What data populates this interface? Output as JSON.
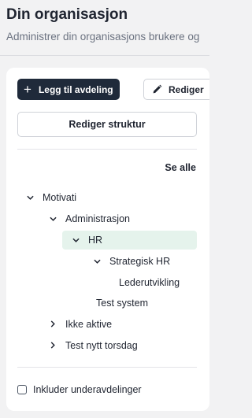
{
  "header": {
    "title": "Din organisasjon",
    "subtitle": "Administrer din organisasjons brukere og"
  },
  "toolbar": {
    "add_label": "Legg til avdeling",
    "edit_label": "Rediger",
    "structure_label": "Rediger struktur"
  },
  "tree": {
    "see_all": "Se alle",
    "nodes": [
      {
        "label": "Motivati",
        "expanded": true
      },
      {
        "label": "Administrasjon",
        "expanded": true
      },
      {
        "label": "HR",
        "expanded": true,
        "selected": true
      },
      {
        "label": "Strategisk HR",
        "expanded": true
      },
      {
        "label": "Lederutvikling"
      },
      {
        "label": "Test system"
      },
      {
        "label": "Ikke aktive",
        "expanded": false
      },
      {
        "label": "Test nytt torsdag",
        "expanded": false
      }
    ]
  },
  "footer": {
    "include_sub_label": "Inkluder underavdelinger",
    "include_sub_checked": false
  },
  "colors": {
    "primary": "#1f2a3a",
    "selected_bg": "#e5f3ec",
    "background": "#f2f2f3"
  },
  "icons": [
    "plus-icon",
    "pencil-icon",
    "chevron-down-icon",
    "chevron-right-icon",
    "checkbox-icon"
  ]
}
